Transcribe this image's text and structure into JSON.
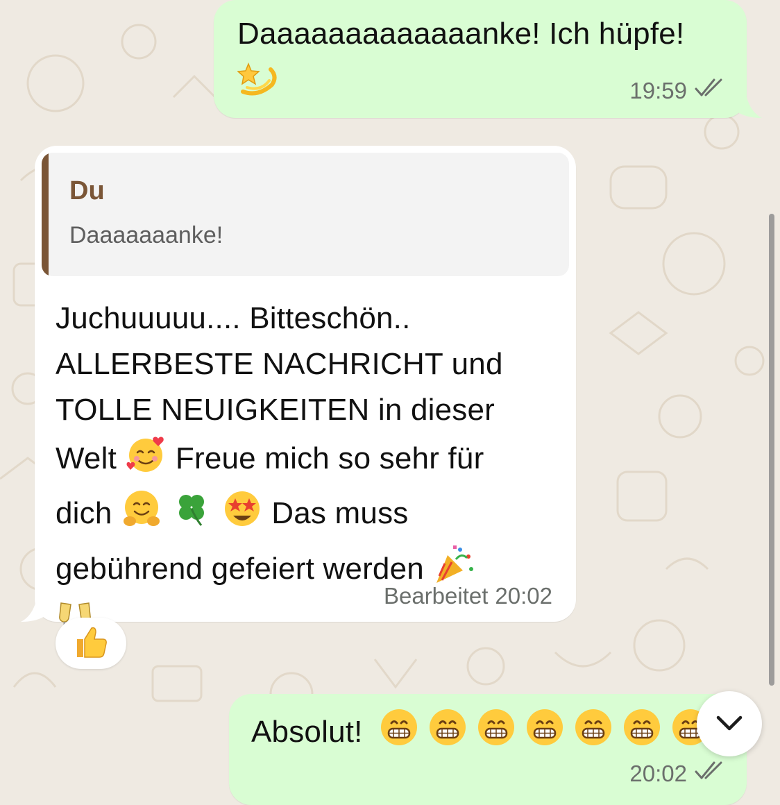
{
  "chat": {
    "messages": [
      {
        "id": "m1",
        "direction": "outgoing",
        "text": "Daaaaaaaaaaaaanke! Ich hüpfe!",
        "emoji": [
          "dizzy-star"
        ],
        "time": "19:59",
        "status": "read"
      },
      {
        "id": "m2",
        "direction": "incoming",
        "quote": {
          "author": "Du",
          "text": "Daaaaaaanke!"
        },
        "lines": [
          "Juchuuuuu.... Bitteschön..",
          "ALLERBESTE NACHRICHT und",
          "TOLLE NEUIGKEITEN in dieser",
          "Welt",
          "Freue mich so sehr für",
          "dich",
          "Das muss",
          "gebührend gefeiert werden"
        ],
        "edited_label": "Bearbeitet",
        "time": "20:02",
        "reaction": "thumbs-up"
      },
      {
        "id": "m3",
        "direction": "outgoing",
        "text": "Absolut!",
        "emoji_count_visible": 7,
        "time": "20:02",
        "status": "read"
      }
    ]
  },
  "controls": {
    "scroll_to_bottom_icon": "chevron-down-icon"
  },
  "colors": {
    "background": "#efeae2",
    "outgoing_bubble": "#d9fdd3",
    "incoming_bubble": "#ffffff",
    "quote_accent": "#7a5536",
    "meta_text": "#6b6f6c",
    "tick_color": "#6b6f6c"
  }
}
